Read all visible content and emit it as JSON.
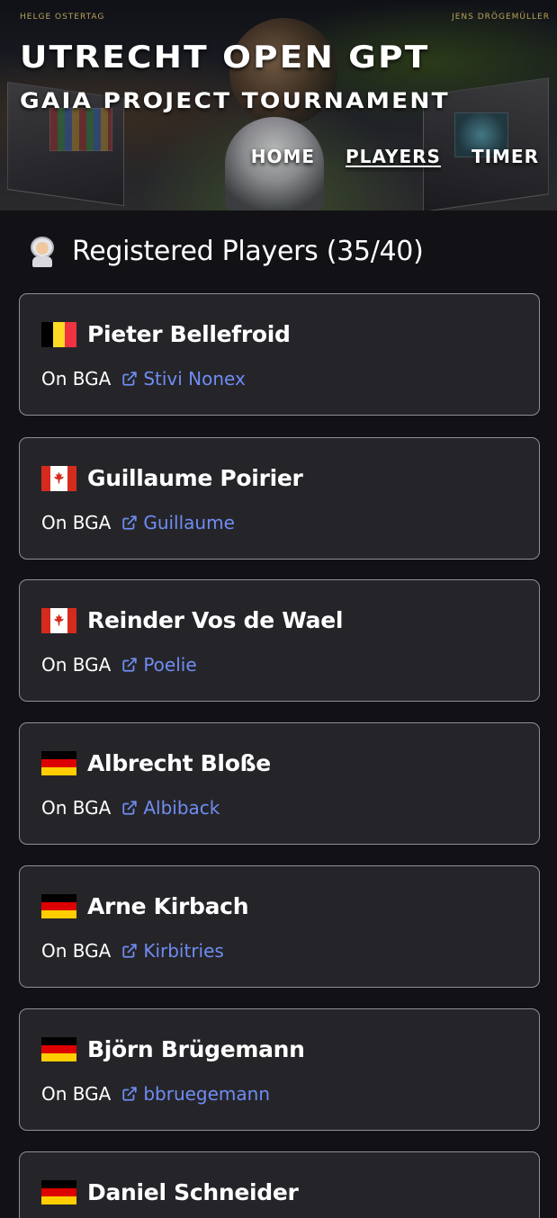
{
  "header": {
    "credit_left": "HELGE OSTERTAG",
    "credit_right": "JENS DRÖGEMÜLLER",
    "title": "UTRECHT OPEN GPT",
    "subtitle": "GAIA PROJECT TOURNAMENT",
    "nav": [
      {
        "label": "HOME",
        "active": false
      },
      {
        "label": "PLAYERS",
        "active": true
      },
      {
        "label": "TIMER",
        "active": false
      }
    ]
  },
  "main": {
    "heading_icon": "astronaut-icon",
    "heading": "Registered Players (35/40)",
    "link_icon": "external-link-icon",
    "players": [
      {
        "name": "Pieter Bellefroid",
        "flag": "belgium-flag-icon",
        "bga_label": "On BGA",
        "bga_name": "Stivi Nonex"
      },
      {
        "name": "Guillaume Poirier",
        "flag": "canada-flag-icon",
        "bga_label": "On BGA",
        "bga_name": "Guillaume"
      },
      {
        "name": "Reinder Vos de Wael",
        "flag": "canada-flag-icon",
        "bga_label": "On BGA",
        "bga_name": "Poelie"
      },
      {
        "name": "Albrecht Bloße",
        "flag": "germany-flag-icon",
        "bga_label": "On BGA",
        "bga_name": "Albiback"
      },
      {
        "name": "Arne Kirbach",
        "flag": "germany-flag-icon",
        "bga_label": "On BGA",
        "bga_name": "Kirbitries"
      },
      {
        "name": "Björn Brügemann",
        "flag": "germany-flag-icon",
        "bga_label": "On BGA",
        "bga_name": "bbruegemann"
      },
      {
        "name": "Daniel Schneider",
        "flag": "germany-flag-icon",
        "bga_label": "",
        "bga_name": ""
      }
    ]
  },
  "colors": {
    "background": "#121216",
    "card": "#252529",
    "card_border": "#8e8e94",
    "link": "#6f8cf2",
    "credit": "#b8a25a"
  }
}
